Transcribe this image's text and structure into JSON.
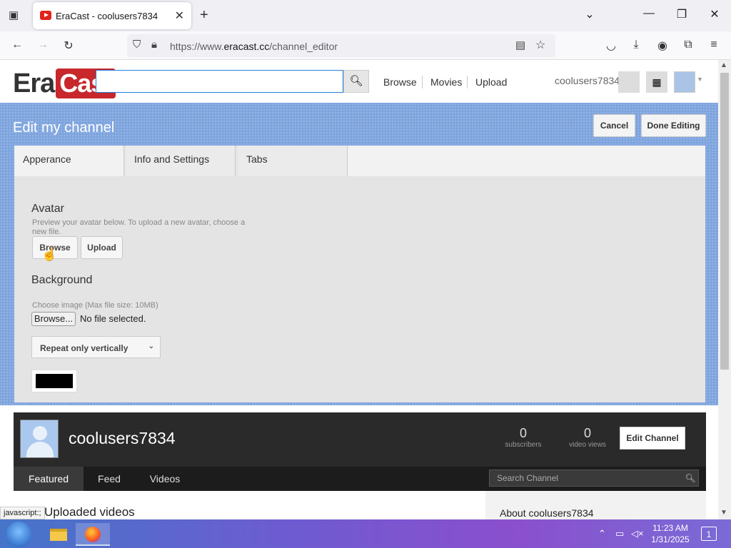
{
  "browser": {
    "tab_title": "EraCast - coolusers7834",
    "new_tab": "+",
    "url_prefix": "https://www.",
    "url_domain": "eracast.cc",
    "url_path": "/channel_editor"
  },
  "site": {
    "logo_era": "Era",
    "logo_cast": "Cast",
    "search_value": "",
    "nav": [
      "Browse",
      "Movies",
      "Upload"
    ],
    "username": "coolusers7834"
  },
  "editor": {
    "title": "Edit my channel",
    "cancel": "Cancel",
    "done": "Done Editing",
    "tabs": [
      "Apperance",
      "Info and Settings",
      "Tabs"
    ],
    "avatar_heading": "Avatar",
    "avatar_help": "Preview your avatar below. To upload a new avatar, choose a new file.",
    "browse": "Browse",
    "upload": "Upload",
    "background_heading": "Background",
    "background_help": "Choose image (Max file size: 10MB)",
    "file_button": "Browse...",
    "file_status": "No file selected.",
    "repeat_option": "Repeat only vertically",
    "bg_color": "#000000"
  },
  "channel": {
    "name": "coolusers7834",
    "subscribers": "0",
    "subscribers_label": "subscribers",
    "views": "0",
    "views_label": "video views",
    "edit_button": "Edit Channel",
    "tabs": [
      "Featured",
      "Feed",
      "Videos"
    ],
    "search_placeholder": "Search Channel",
    "uploaded_heading": "Uploaded videos",
    "about_heading": "About coolusers7834"
  },
  "status_text": "javascript:;",
  "taskbar": {
    "time": "11:23 AM",
    "date": "1/31/2025",
    "notifications": "1"
  },
  "colors": {
    "accent": "#c8282b",
    "band": "#7ea4de"
  }
}
